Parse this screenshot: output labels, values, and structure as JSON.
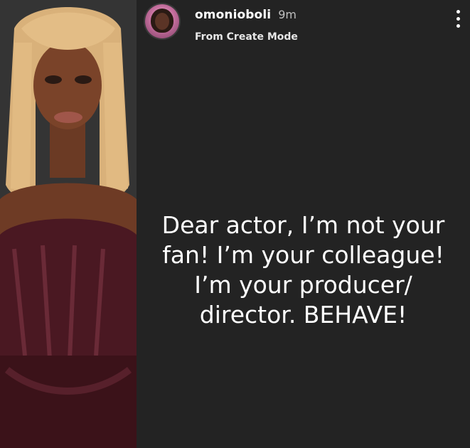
{
  "story": {
    "username": "omonioboli",
    "time": "9m",
    "subtitle": "From Create Mode",
    "caption_lines": [
      "Dear actor, I’m not your",
      "fan! I’m your colleague!",
      "I’m your producer/",
      "director. BEHAVE!"
    ]
  },
  "icons": {
    "more": "more-vertical-icon"
  },
  "colors": {
    "story_background": "#232323",
    "text_primary": "#ffffff",
    "text_secondary": "#bfbfbf"
  }
}
